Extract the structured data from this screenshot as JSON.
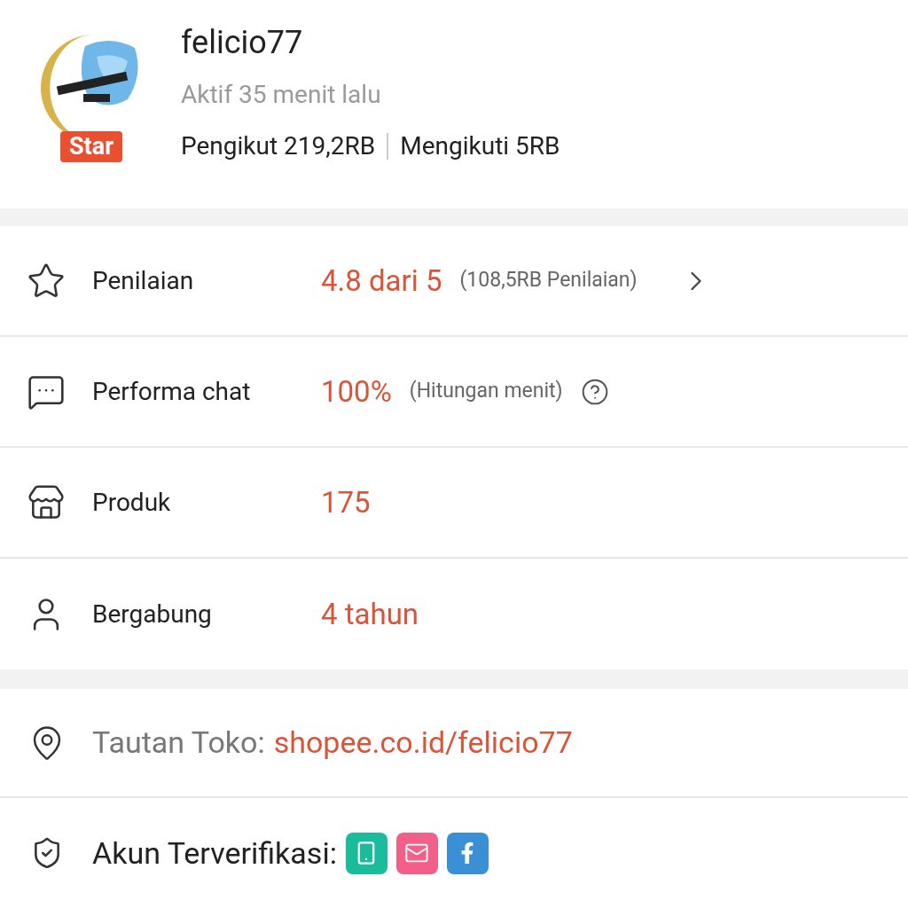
{
  "profile": {
    "badge": "Star",
    "name": "felicio77",
    "status": "Aktif 35 menit lalu",
    "stats": [
      "Pengikut 219,2RB",
      "Mengikuti 5RB"
    ]
  },
  "stats": [
    {
      "label": "Penilaian",
      "value": "4.8 dari 5",
      "note": "(108,5RB Penilaian)"
    },
    {
      "label": "Performa chat",
      "value": "100%",
      "note": "(Hitungan menit)"
    },
    {
      "label": "Produk",
      "value": "175"
    },
    {
      "label": "Bergabung",
      "value": "4 tahun"
    }
  ],
  "shop_link": {
    "label": "Tautan Toko:",
    "url": "shopee.co.id/felicio77"
  },
  "verified": {
    "label": "Akun Terverifikasi:",
    "methods": [
      {
        "kind": "phone",
        "color": "#1abc9c"
      },
      {
        "kind": "email",
        "color": "#f2608a"
      },
      {
        "kind": "facebook",
        "color": "#3b8fd4"
      }
    ]
  }
}
